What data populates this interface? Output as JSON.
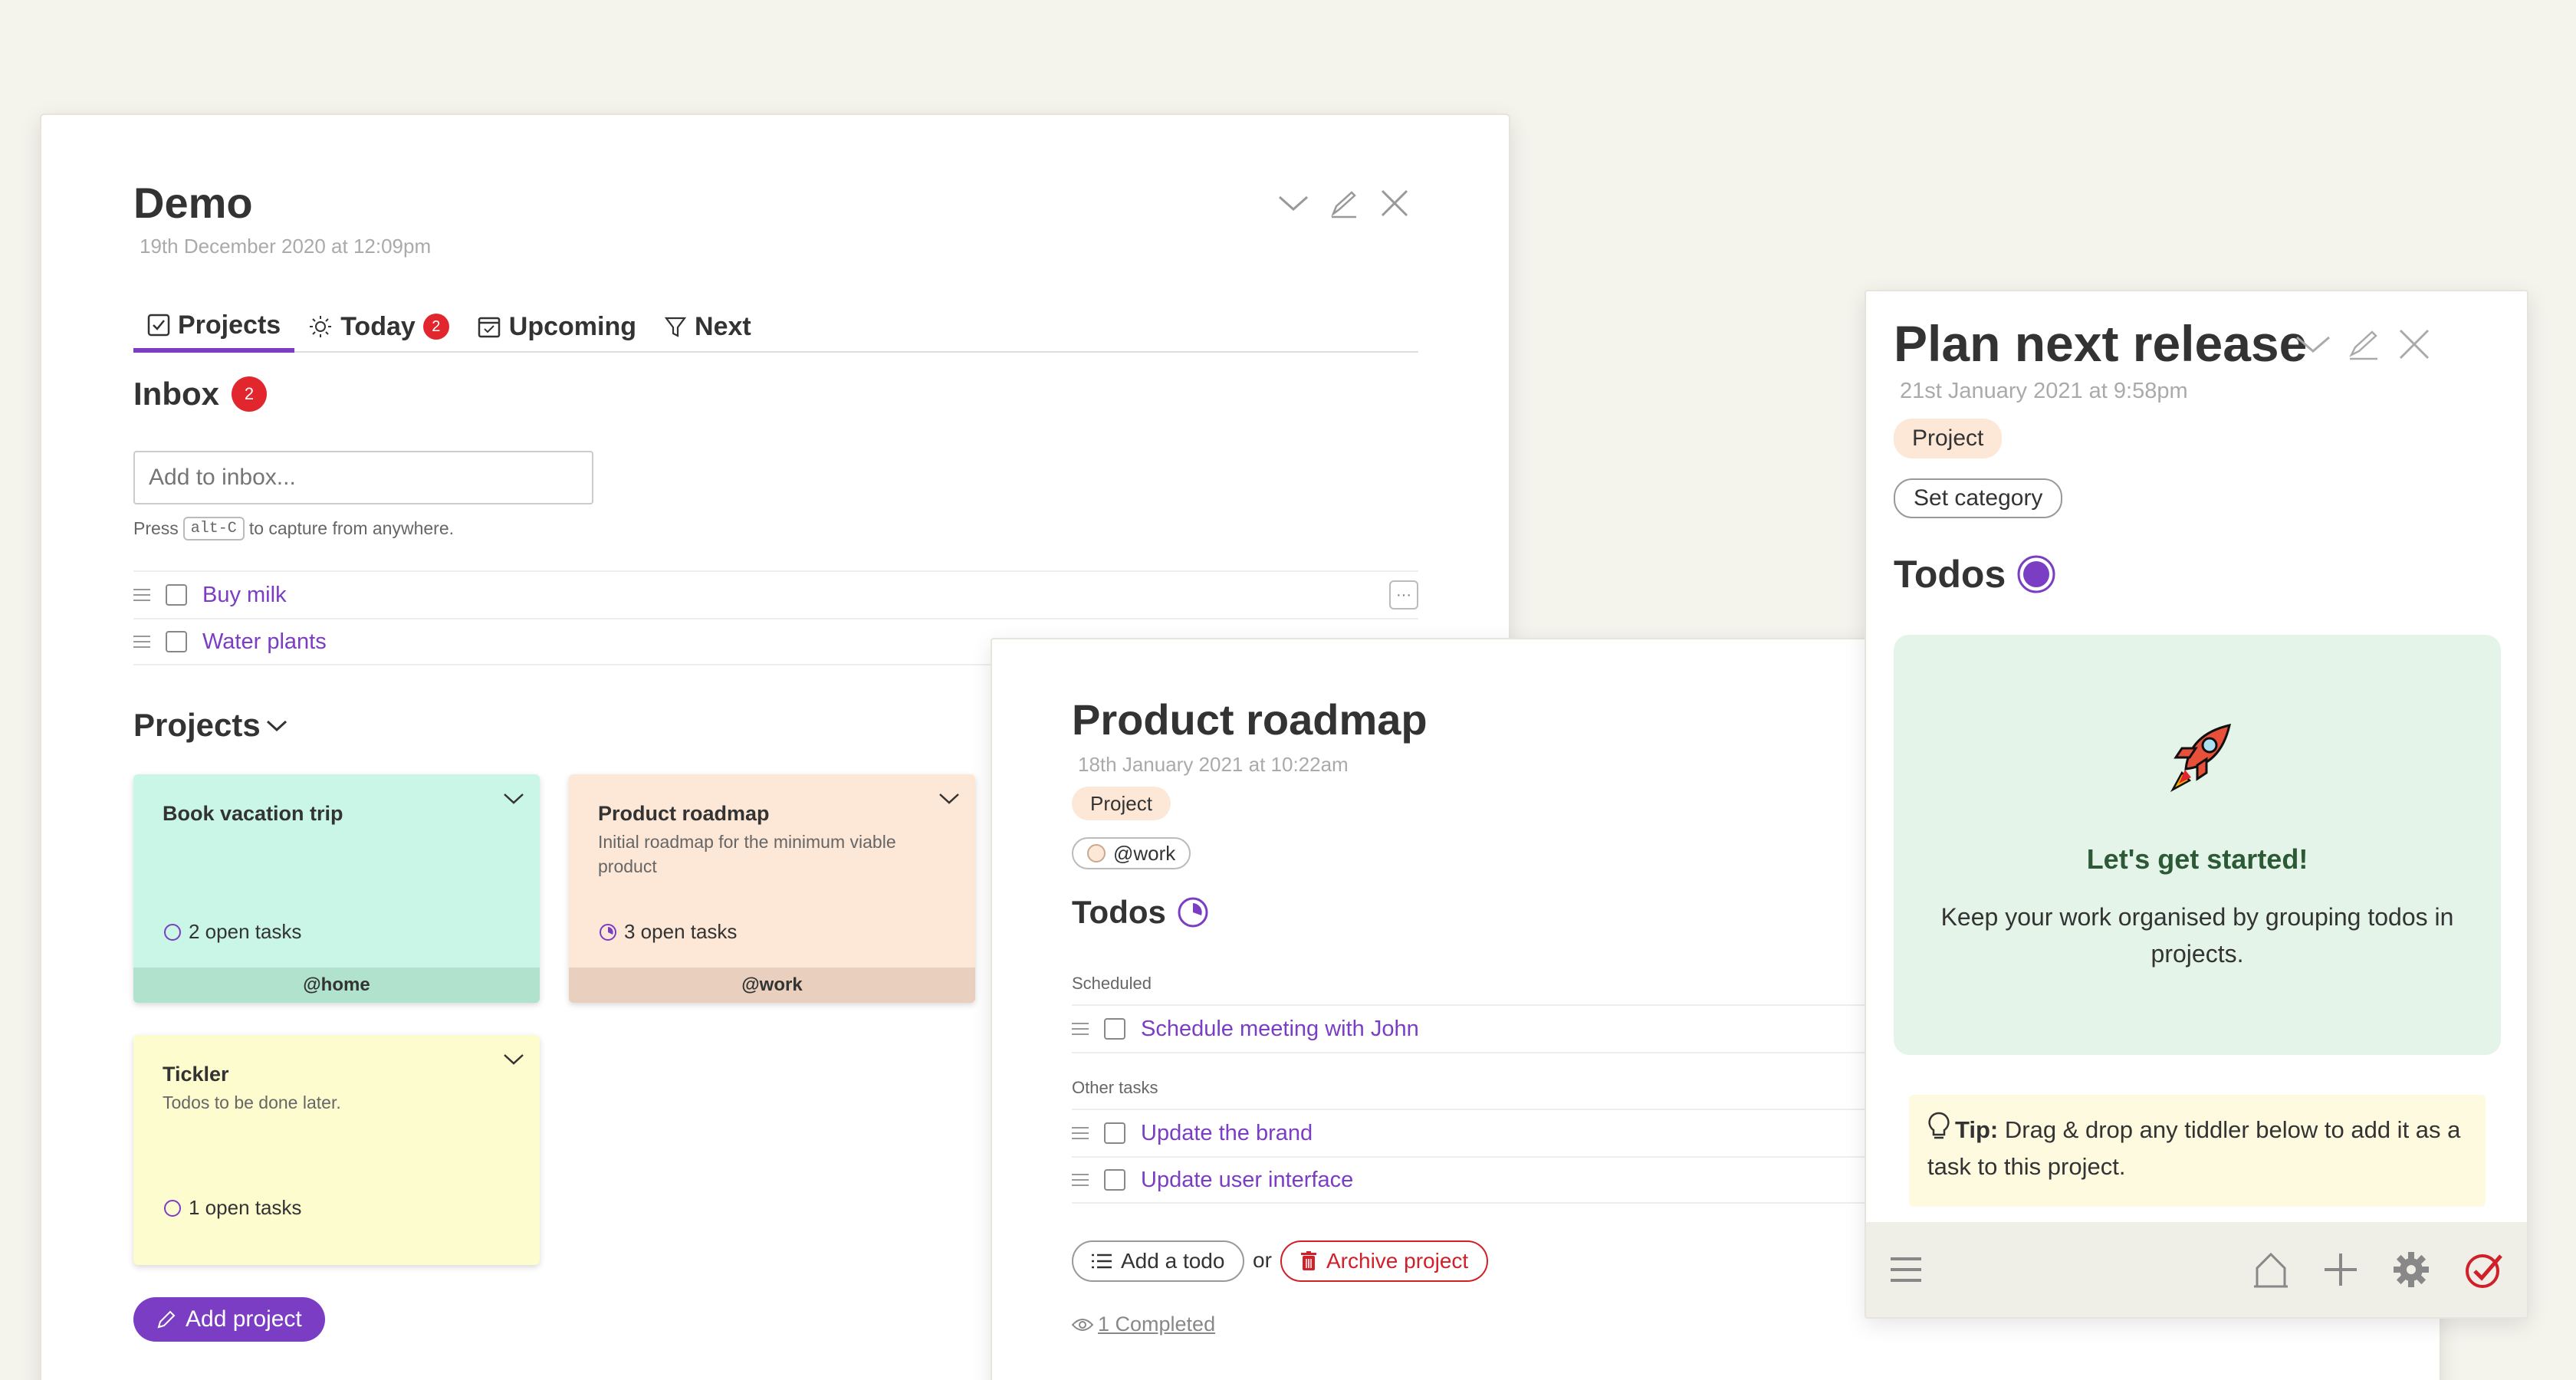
{
  "demo": {
    "title": "Demo",
    "subtitle": "19th December 2020 at 12:09pm",
    "tabs": [
      {
        "label": "Projects",
        "icon": "checkbox-icon",
        "active": true
      },
      {
        "label": "Today",
        "icon": "sun-icon",
        "badge": "2"
      },
      {
        "label": "Upcoming",
        "icon": "calendar-icon"
      },
      {
        "label": "Next",
        "icon": "filter-icon"
      }
    ],
    "inbox": {
      "heading": "Inbox",
      "badge": "2",
      "placeholder": "Add to inbox...",
      "hint_prefix": "Press",
      "hint_key": "alt-C",
      "hint_suffix": "to capture from anywhere.",
      "items": [
        "Buy milk",
        "Water plants"
      ]
    },
    "projects_heading": "Projects",
    "projects": [
      {
        "title": "Book vacation trip",
        "description": "",
        "open": "2 open tasks",
        "tag": "@home",
        "color": "#c9f6e6",
        "footer_color": "#b0e2cd"
      },
      {
        "title": "Product roadmap",
        "description": "Initial roadmap for the minimum viable product",
        "open": "3 open tasks",
        "tag": "@work",
        "color": "#fde7d6",
        "footer_color": "#e9d0be"
      },
      {
        "title": "Tickler",
        "description": "Todos to be done later.",
        "open": "1 open tasks",
        "tag": "",
        "color": "#fcfccf",
        "footer_color": ""
      }
    ],
    "add_project": "Add project"
  },
  "roadmap": {
    "title": "Product roadmap",
    "subtitle": "18th January 2021 at 10:22am",
    "tag_project": "Project",
    "tag_work": "@work",
    "todos_heading": "Todos",
    "scheduled_label": "Scheduled",
    "scheduled": [
      "Schedule meeting with John"
    ],
    "other_label": "Other tasks",
    "other": [
      "Update the brand",
      "Update user interface"
    ],
    "add_todo": "Add a todo",
    "or": "or",
    "archive": "Archive project",
    "completed": "1 Completed"
  },
  "plan": {
    "title": "Plan next release",
    "subtitle": "21st January 2021 at 9:58pm",
    "tag_project": "Project",
    "set_category": "Set category",
    "todos_heading": "Todos",
    "empty_title": "Let's get started!",
    "empty_text": "Keep your work organised by grouping todos in projects.",
    "tip_label": "Tip:",
    "tip_text": "Drag & drop any tiddler below to add it as a task to this project."
  },
  "colors": {
    "accent": "#7a3dc4",
    "badge": "#e2262e",
    "archive": "#d0202a",
    "empty_state_bg": "#e5f4e9",
    "empty_title": "#2d5a36",
    "tip_bg": "#fdfadf",
    "project_tag_bg": "#fde7d6"
  }
}
